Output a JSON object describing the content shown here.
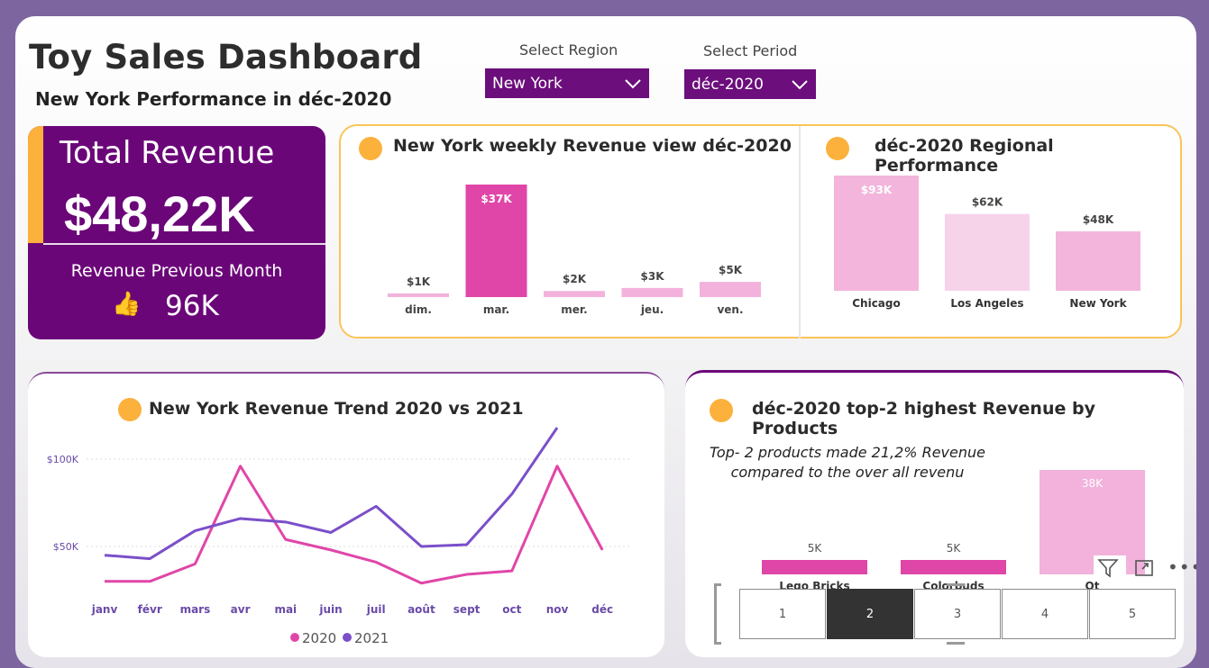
{
  "header": {
    "title": "Toy Sales Dashboard",
    "subtitle": "New York Performance in déc-2020"
  },
  "filters": {
    "region": {
      "label": "Select Region",
      "value": "New York"
    },
    "period": {
      "label": "Select Period",
      "value": "déc-2020"
    }
  },
  "kpi": {
    "total_label": "Total Revenue",
    "total_value": "$48,22K",
    "prev_label": "Revenue Previous Month",
    "prev_value": "96K",
    "thumb_icon": "thumbs-up-icon"
  },
  "weekly": {
    "title": "New York weekly Revenue view déc-2020"
  },
  "regional": {
    "title": "déc-2020 Regional Performance"
  },
  "trend": {
    "title": "New York Revenue Trend 2020 vs 2021"
  },
  "products": {
    "title": "déc-2020 top-2 highest Revenue by Products",
    "note_line1": "Top- 2 products made 21,2% Revenue",
    "note_line2": "compared to the over all revenu"
  },
  "pager": {
    "pages": [
      "1",
      "2",
      "3",
      "4",
      "5"
    ],
    "active": "2"
  },
  "colors": {
    "brand": "#6b0679",
    "accent": "#fbb13c",
    "pink": "#e046a8",
    "light_pink": "#f2b2dc",
    "purple": "#7b4fc9"
  },
  "chart_data": [
    {
      "type": "bar",
      "id": "weekly",
      "categories": [
        "dim.",
        "mar.",
        "mer.",
        "jeu.",
        "ven."
      ],
      "values": [
        1,
        37,
        2,
        3,
        5
      ],
      "labels": [
        "$1K",
        "$37K",
        "$2K",
        "$3K",
        "$5K"
      ],
      "highlight": "mar."
    },
    {
      "type": "bar",
      "id": "regional",
      "categories": [
        "Chicago",
        "Los Angeles",
        "New York"
      ],
      "values": [
        93,
        62,
        48
      ],
      "labels": [
        "$93K",
        "$62K",
        "$48K"
      ]
    },
    {
      "type": "line",
      "id": "trend",
      "categories": [
        "janv",
        "févr",
        "mars",
        "avr",
        "mai",
        "juin",
        "juil",
        "août",
        "sept",
        "oct",
        "nov",
        "déc"
      ],
      "yticks": [
        "$50K",
        "$100K"
      ],
      "series": [
        {
          "name": "2020",
          "color": "#e046a8",
          "values": [
            30,
            30,
            40,
            96,
            54,
            48,
            41,
            29,
            34,
            36,
            96,
            48
          ]
        },
        {
          "name": "2021",
          "color": "#7b4fc9",
          "values": [
            45,
            43,
            59,
            66,
            64,
            58,
            73,
            50,
            51,
            80,
            118,
            null
          ]
        }
      ]
    },
    {
      "type": "bar",
      "id": "products",
      "categories": [
        "Lego Bricks",
        "Colorbuds",
        "Ot"
      ],
      "values": [
        5,
        5,
        38
      ],
      "labels": [
        "5K",
        "5K",
        "38K"
      ]
    }
  ]
}
